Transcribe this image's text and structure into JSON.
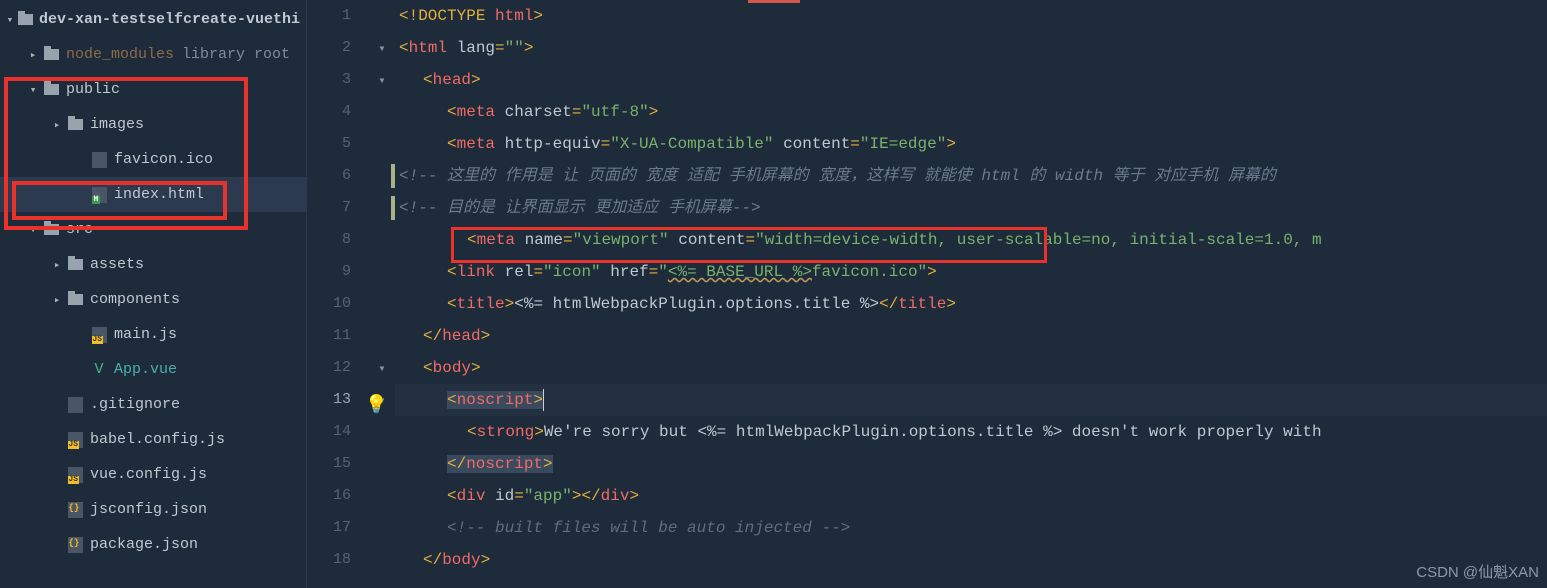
{
  "sidebar": {
    "project": "dev-xan-testselfcreate-vuethi",
    "node_modules": "node_modules",
    "node_modules_suffix": "library root",
    "public": "public",
    "images": "images",
    "favicon": "favicon.ico",
    "index_html": "index.html",
    "src": "src",
    "assets": "assets",
    "components": "components",
    "main_js": "main.js",
    "app_vue": "App.vue",
    "gitignore": ".gitignore",
    "babel": "babel.config.js",
    "vueconfig": "vue.config.js",
    "jsconfig": "jsconfig.json",
    "package": "package.json"
  },
  "gutter": [
    "1",
    "2",
    "3",
    "4",
    "5",
    "6",
    "7",
    "8",
    "9",
    "10",
    "11",
    "12",
    "13",
    "14",
    "15",
    "16",
    "17",
    "18"
  ],
  "code": {
    "l1": {
      "p1": "<!",
      "p2": "DOCTYPE ",
      "p3": "html",
      "p4": ">"
    },
    "l2": {
      "p1": "<",
      "p2": "html ",
      "p3": "lang",
      "p4": "=",
      "p5": "\"\"",
      "p6": ">"
    },
    "l3": {
      "p1": "<",
      "p2": "head",
      "p3": ">"
    },
    "l4": {
      "p1": "<",
      "p2": "meta ",
      "p3": "charset",
      "p4": "=",
      "p5": "\"utf-8\"",
      "p6": ">"
    },
    "l5": {
      "p1": "<",
      "p2": "meta ",
      "p3": "http-equiv",
      "p4": "=",
      "p5": "\"X-UA-Compatible\" ",
      "p6": "content",
      "p7": "=",
      "p8": "\"IE=edge\"",
      "p9": ">"
    },
    "l6": {
      "p1": "<!--       这里的 作用是 让 页面的 宽度 适配 手机屏幕的 宽度，这样写 就能使 html 的 width 等于 对应手机 屏幕的 "
    },
    "l7": {
      "p1": "<!--       目的是 让界面显示 更加适应 手机屏幕-->"
    },
    "l8": {
      "p1": "<",
      "p2": "meta ",
      "p3": "name",
      "p4": "=",
      "p5": "\"viewport\" ",
      "p6": "content",
      "p7": "=",
      "p8": "\"width=device-width",
      "p9": ", user-scalable=no, initial-scale=1.0, m"
    },
    "l9": {
      "p1": "<",
      "p2": "link ",
      "p3": "rel",
      "p4": "=",
      "p5": "\"icon\" ",
      "p6": "href",
      "p7": "=",
      "p8": "\"",
      "p9": "<%= BASE_URL %>",
      "p10": "favicon.ico\"",
      "p11": ">"
    },
    "l10": {
      "p1": "<",
      "p2": "title",
      "p3": ">",
      "p4": "<%= htmlWebpackPlugin.options.title %>",
      "p5": "</",
      "p6": "title",
      "p7": ">"
    },
    "l11": {
      "p1": "</",
      "p2": "head",
      "p3": ">"
    },
    "l12": {
      "p1": "<",
      "p2": "body",
      "p3": ">"
    },
    "l13": {
      "p1": "<",
      "p2": "noscript",
      "p3": ">"
    },
    "l14": {
      "p1": "<",
      "p2": "strong",
      "p3": ">",
      "p4": "We're sorry but <%= htmlWebpackPlugin.options.title %> doesn't work properly with"
    },
    "l15": {
      "p1": "</",
      "p2": "noscript",
      "p3": ">"
    },
    "l16": {
      "p1": "<",
      "p2": "div ",
      "p3": "id",
      "p4": "=",
      "p5": "\"app\"",
      "p6": "></",
      "p7": "div",
      "p8": ">"
    },
    "l17": {
      "p1": "<!-- built files will be auto injected -->"
    },
    "l18": {
      "p1": "</",
      "p2": "body",
      "p3": ">"
    }
  },
  "watermark": "CSDN @仙魁XAN"
}
